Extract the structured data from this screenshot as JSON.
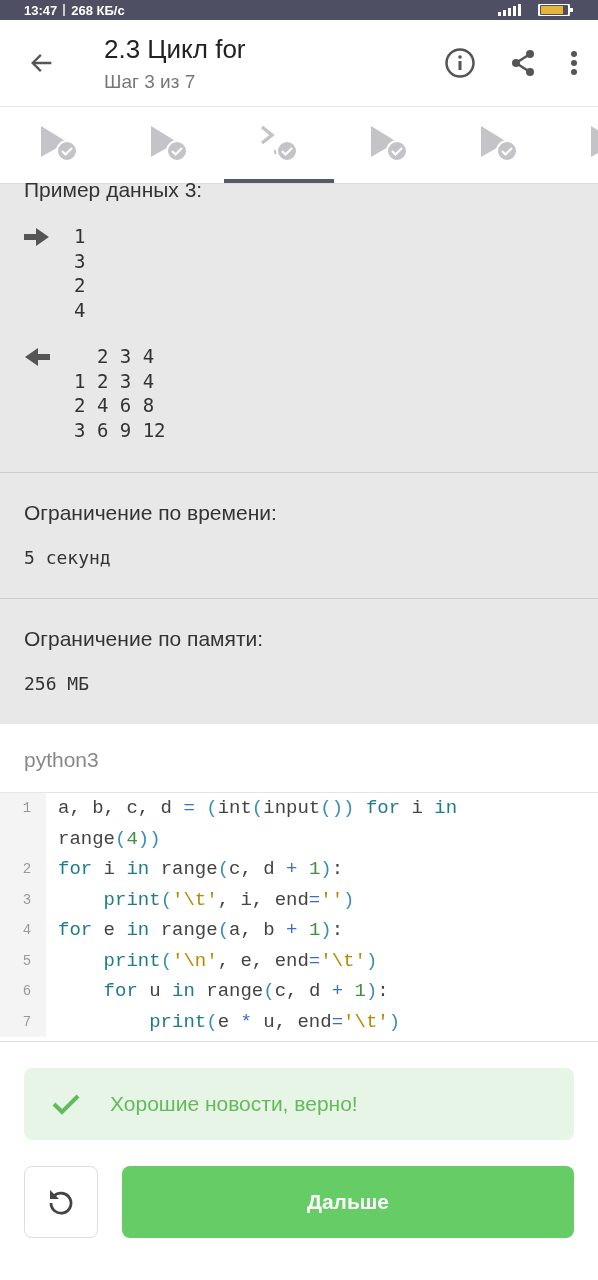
{
  "status_bar": {
    "time": "13:47",
    "speed": "268 КБ/с"
  },
  "header": {
    "title": "2.3 Цикл for",
    "subtitle": "Шаг 3 из 7"
  },
  "steps": [
    {
      "kind": "video",
      "selected": false,
      "passed": true
    },
    {
      "kind": "video",
      "selected": false,
      "passed": true
    },
    {
      "kind": "code",
      "selected": true,
      "passed": true
    },
    {
      "kind": "video",
      "selected": false,
      "passed": true
    },
    {
      "kind": "video",
      "selected": false,
      "passed": true
    },
    {
      "kind": "video",
      "selected": false
    }
  ],
  "sample": {
    "title": "Пример данных 3:",
    "input": [
      "1",
      "3",
      "2",
      "4"
    ],
    "output": [
      "  2 3 4",
      "1 2 3 4",
      "2 4 6 8",
      "3 6 9 12"
    ]
  },
  "limits": [
    {
      "label": "Ограничение по времени:",
      "value": "5 секунд"
    },
    {
      "label": "Ограничение по памяти:",
      "value": "256 МБ"
    }
  ],
  "language": "python3",
  "code": [
    {
      "number": "1",
      "tokens": [
        {
          "kind": "plain",
          "text": "a, b, c, d "
        },
        {
          "kind": "op",
          "text": "= "
        },
        {
          "kind": "paren",
          "text": "("
        },
        {
          "kind": "plain",
          "text": "int"
        },
        {
          "kind": "paren",
          "text": "("
        },
        {
          "kind": "plain",
          "text": "input"
        },
        {
          "kind": "paren",
          "text": "()) "
        },
        {
          "kind": "keyword",
          "text": "for"
        },
        {
          "kind": "plain",
          "text": " i "
        },
        {
          "kind": "keyword",
          "text": "in"
        },
        {
          "kind": "plain",
          "text": " range"
        },
        {
          "kind": "paren",
          "text": "("
        },
        {
          "kind": "number",
          "text": "4"
        },
        {
          "kind": "paren",
          "text": "))"
        }
      ]
    },
    {
      "number": "2",
      "tokens": [
        {
          "kind": "keyword",
          "text": "for"
        },
        {
          "kind": "plain",
          "text": " i "
        },
        {
          "kind": "keyword",
          "text": "in"
        },
        {
          "kind": "plain",
          "text": " range"
        },
        {
          "kind": "paren",
          "text": "("
        },
        {
          "kind": "plain",
          "text": "c, d "
        },
        {
          "kind": "op",
          "text": "+ "
        },
        {
          "kind": "number",
          "text": "1"
        },
        {
          "kind": "paren",
          "text": ")"
        },
        {
          "kind": "plain",
          "text": ":"
        }
      ]
    },
    {
      "number": "3",
      "tokens": [
        {
          "kind": "keyword",
          "text": "    print"
        },
        {
          "kind": "paren",
          "text": "("
        },
        {
          "kind": "string",
          "text": "'\\t'"
        },
        {
          "kind": "plain",
          "text": ", i, end"
        },
        {
          "kind": "op",
          "text": "="
        },
        {
          "kind": "string",
          "text": "''"
        },
        {
          "kind": "paren",
          "text": ")"
        }
      ]
    },
    {
      "number": "4",
      "tokens": [
        {
          "kind": "keyword",
          "text": "for"
        },
        {
          "kind": "plain",
          "text": " e "
        },
        {
          "kind": "keyword",
          "text": "in"
        },
        {
          "kind": "plain",
          "text": " range"
        },
        {
          "kind": "paren",
          "text": "("
        },
        {
          "kind": "plain",
          "text": "a, b "
        },
        {
          "kind": "op",
          "text": "+ "
        },
        {
          "kind": "number",
          "text": "1"
        },
        {
          "kind": "paren",
          "text": ")"
        },
        {
          "kind": "plain",
          "text": ":"
        }
      ]
    },
    {
      "number": "5",
      "tokens": [
        {
          "kind": "keyword",
          "text": "    print"
        },
        {
          "kind": "paren",
          "text": "("
        },
        {
          "kind": "string",
          "text": "'\\n'"
        },
        {
          "kind": "plain",
          "text": ", e, end"
        },
        {
          "kind": "op",
          "text": "="
        },
        {
          "kind": "string",
          "text": "'\\t'"
        },
        {
          "kind": "paren",
          "text": ")"
        }
      ]
    },
    {
      "number": "6",
      "tokens": [
        {
          "kind": "keyword",
          "text": "    for"
        },
        {
          "kind": "plain",
          "text": " u "
        },
        {
          "kind": "keyword",
          "text": "in"
        },
        {
          "kind": "plain",
          "text": " range"
        },
        {
          "kind": "paren",
          "text": "("
        },
        {
          "kind": "plain",
          "text": "c, d "
        },
        {
          "kind": "op",
          "text": "+ "
        },
        {
          "kind": "number",
          "text": "1"
        },
        {
          "kind": "paren",
          "text": ")"
        },
        {
          "kind": "plain",
          "text": ":"
        }
      ]
    },
    {
      "number": "7",
      "tokens": [
        {
          "kind": "keyword",
          "text": "        print"
        },
        {
          "kind": "paren",
          "text": "("
        },
        {
          "kind": "plain",
          "text": "e "
        },
        {
          "kind": "op",
          "text": "*"
        },
        {
          "kind": "plain",
          "text": " u, end"
        },
        {
          "kind": "op",
          "text": "="
        },
        {
          "kind": "string",
          "text": "'\\t'"
        },
        {
          "kind": "paren",
          "text": ")"
        }
      ]
    }
  ],
  "result": {
    "kind": "success",
    "message": "Хорошие новости, верно!"
  },
  "next_button": "Дальше"
}
